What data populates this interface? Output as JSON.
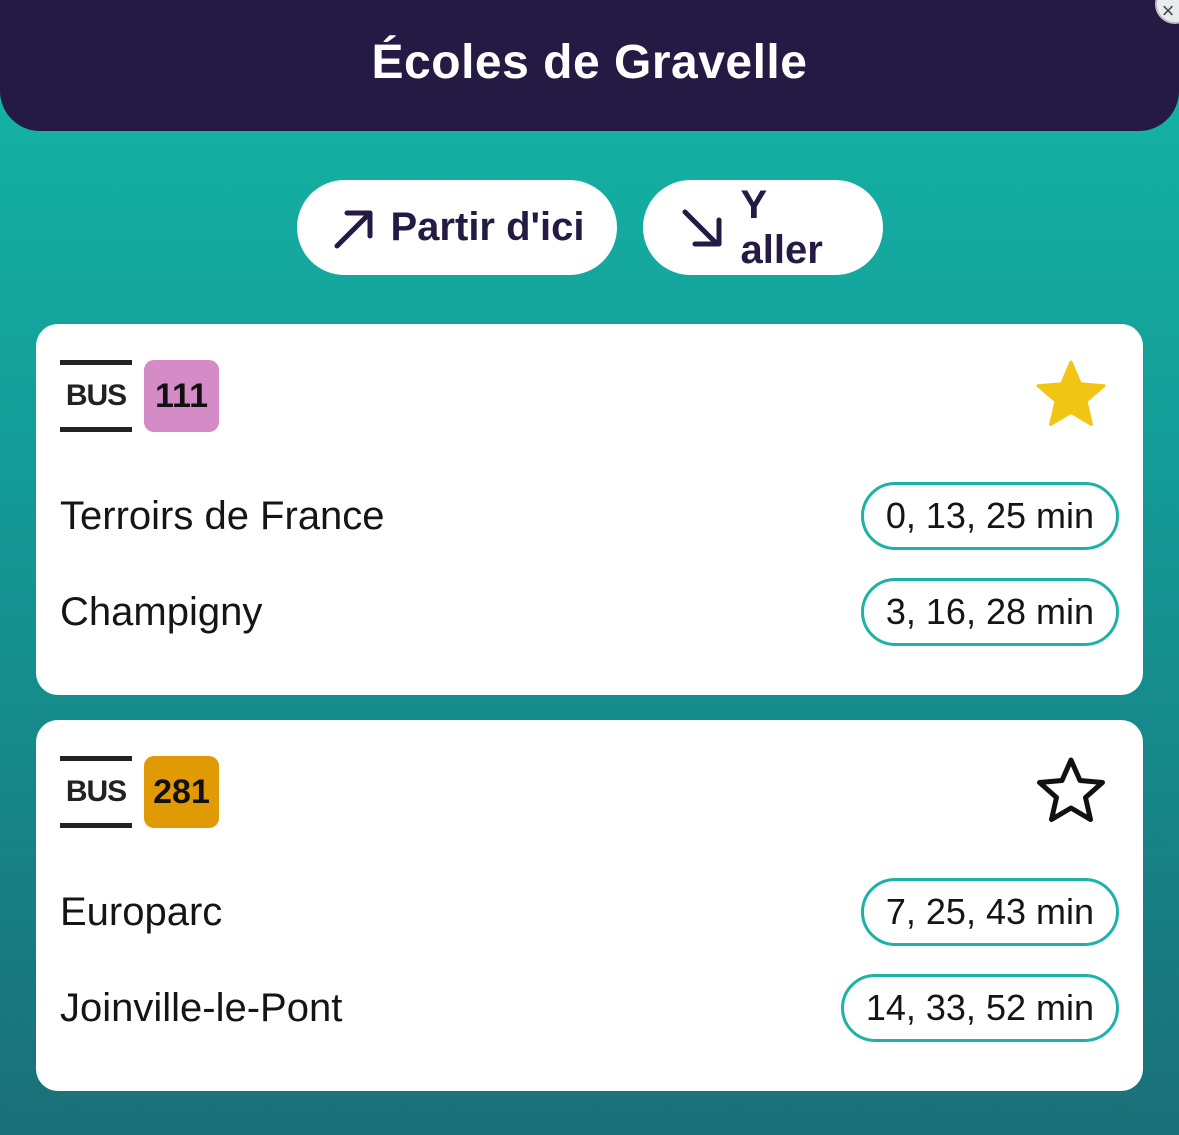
{
  "header": {
    "title": "Écoles de Gravelle",
    "close_glyph": "×"
  },
  "actions": {
    "depart_label": "Partir d'ici",
    "depart_icon": "arrow-up-right-icon",
    "arrive_label": "Y aller",
    "arrive_icon": "arrow-down-right-icon"
  },
  "routes": [
    {
      "mode": "BUS",
      "line": "111",
      "line_color": "#d58bc5",
      "favorite": true,
      "favorite_color": "#f2c413",
      "departures": [
        {
          "destination": "Terroirs de France",
          "times": "0, 13, 25 min"
        },
        {
          "destination": "Champigny",
          "times": "3, 16, 28 min"
        }
      ]
    },
    {
      "mode": "BUS",
      "line": "281",
      "line_color": "#e09a05",
      "favorite": false,
      "favorite_color": "#111111",
      "departures": [
        {
          "destination": "Europarc",
          "times": "7, 25, 43 min"
        },
        {
          "destination": "Joinville-le-Pont",
          "times": "14, 33, 52 min"
        }
      ]
    }
  ],
  "colors": {
    "header_bg": "#251a44",
    "accent": "#1cb3a6",
    "background_top": "#14b8a6",
    "background_bottom": "#1a6f78"
  }
}
